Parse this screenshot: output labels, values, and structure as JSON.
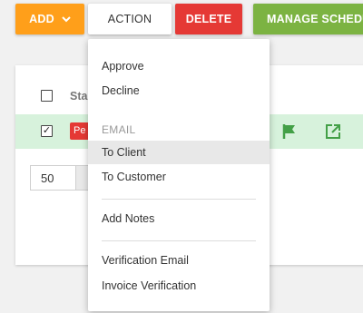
{
  "toolbar": {
    "add_label": "ADD",
    "action_label": "ACTION",
    "delete_label": "DELETE",
    "manage_label": "MANAGE SCHEDULE"
  },
  "table": {
    "header_status": "Sta",
    "row_badge": "Pe"
  },
  "pager": {
    "page_size": "50"
  },
  "menu": {
    "approve": "Approve",
    "decline": "Decline",
    "email_header": "EMAIL",
    "to_client": "To Client",
    "to_customer": "To Customer",
    "add_notes": "Add Notes",
    "verification_email": "Verification Email",
    "invoice_verification": "Invoice Verification"
  },
  "colors": {
    "add": "#ff9f1a",
    "delete": "#e53935",
    "manage": "#7cb342",
    "row_highlight": "#d7f2dc",
    "icon_green": "#43a047"
  }
}
